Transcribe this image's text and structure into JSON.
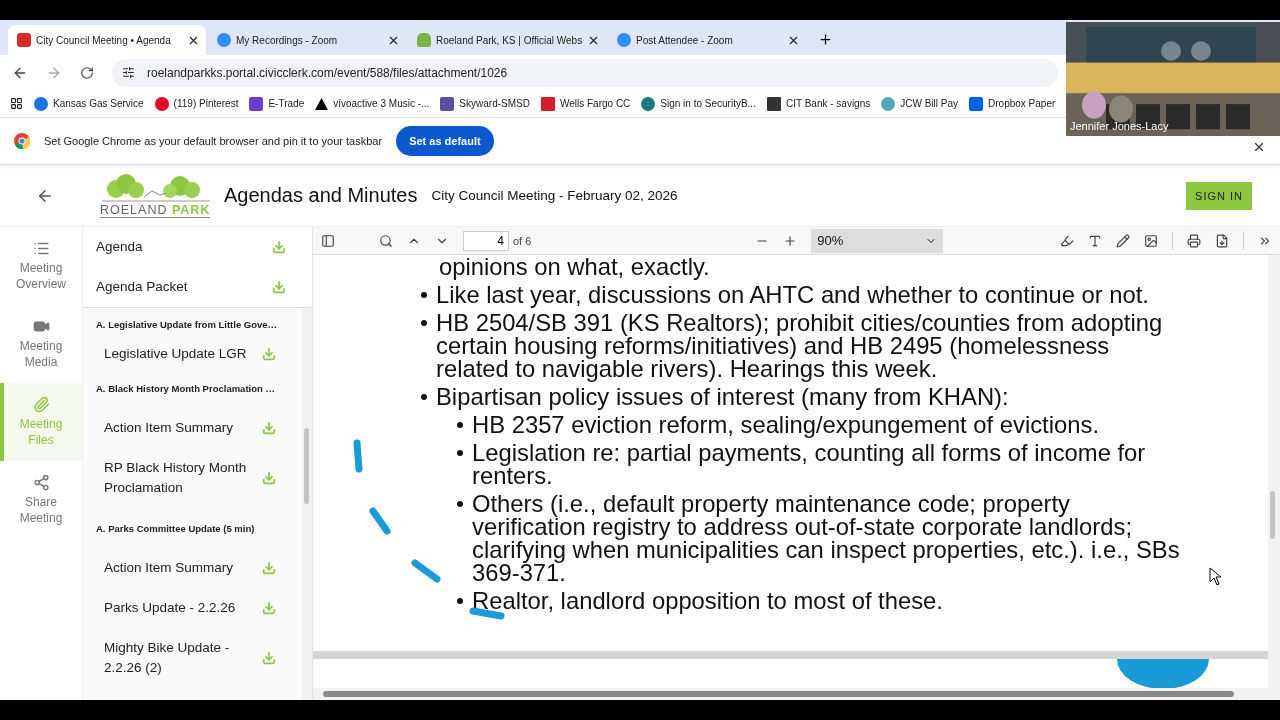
{
  "browser": {
    "tabs": [
      {
        "kind": "civic",
        "title": "City Council Meeting • Agenda",
        "selected": true
      },
      {
        "kind": "zoom",
        "title": "My Recordings - Zoom",
        "selected": false
      },
      {
        "kind": "site",
        "title": "Roeland Park, KS | Official Webs",
        "selected": false
      },
      {
        "kind": "zoom",
        "title": "Post Attendee - Zoom",
        "selected": false
      }
    ],
    "url": "roelandparkks.portal.civicclerk.com/event/588/files/attachment/1026",
    "bookmarks": [
      {
        "kind": "gas",
        "label": "Kansas Gas Service"
      },
      {
        "kind": "pinterest",
        "label": "(119) Pinterest"
      },
      {
        "kind": "etrade",
        "label": "E-Trade"
      },
      {
        "kind": "garmin",
        "label": "vívoactive 3 Music -..."
      },
      {
        "kind": "skyward",
        "label": "Skyward-SMSD"
      },
      {
        "kind": "wellsfargo",
        "label": "Wells Fargo CC"
      },
      {
        "kind": "security",
        "label": "Sign in to SecurityB..."
      },
      {
        "kind": "cit",
        "label": "CIT Bank - savigns"
      },
      {
        "kind": "jcw",
        "label": "JCW Bill Pay"
      },
      {
        "kind": "dropbox",
        "label": "Dropbox Paper"
      }
    ],
    "banner": {
      "message": "Set Google Chrome as your default browser and pin it to your taskbar",
      "button": "Set as default"
    }
  },
  "video": {
    "kind": "picture",
    "name": "Jennifer Jones-Lacy"
  },
  "header": {
    "logo": [
      "ROELAND",
      "PARK"
    ],
    "title": "Agendas and Minutes",
    "meeting": "City Council Meeting - February 02, 2026",
    "sign_in": "SIGN IN"
  },
  "nav": [
    {
      "kind": "list",
      "lines": [
        "Meeting",
        "Overview"
      ],
      "selected": false
    },
    {
      "kind": "video",
      "lines": [
        "Meeting",
        "Media"
      ],
      "selected": false
    },
    {
      "kind": "clip",
      "lines": [
        "Meeting",
        "Files"
      ],
      "selected": true
    },
    {
      "kind": "share",
      "lines": [
        "Share",
        "Meeting"
      ],
      "selected": false
    }
  ],
  "files": {
    "pinned": [
      {
        "label": "Agenda"
      },
      {
        "label": "Agenda Packet"
      }
    ],
    "sections": [
      {
        "title": "A. Legislative Update from Little Gove…",
        "files": [
          {
            "label": "Legislative Update LGR"
          }
        ]
      },
      {
        "title": "A. Black History Month Proclamation …",
        "files": [
          {
            "label": "Action Item Summary"
          },
          {
            "label": "RP Black History Month Proclamation"
          }
        ]
      },
      {
        "title": "A. Parks Committee Update (5 min)",
        "files": [
          {
            "label": "Action Item Summary"
          },
          {
            "label": "Parks Update - 2.2.26"
          },
          {
            "label": "Mighty Bike Update - 2.2.26 (2)"
          }
        ]
      }
    ]
  },
  "viewer": {
    "page": "4",
    "of": "of 6",
    "zoom": "90%",
    "lead": "opinions on what, exactly.",
    "bullets": [
      {
        "text": "Like last year, discussions on AHTC and whether to continue or not."
      },
      {
        "text": "HB 2504/SB 391 (KS Realtors); prohibit cities/counties from adopting certain housing reforms/initiatives) and HB 2495 (homelessness related to navigable rivers). Hearings this week."
      },
      {
        "text": "Bipartisan policy issues of interest (many from KHAN):",
        "children": [
          {
            "text": "HB 2357 eviction reform, sealing/expungement of evictions."
          },
          {
            "text": "Legislation re: partial payments, counting all forms of income for renters."
          },
          {
            "text": "Others (i.e., default property maintenance code; property verification registry to address out-of-state corporate landlords; clarifying when municipalities can inspect properties, etc.). i.e., SBs 369-371."
          },
          {
            "text": "Realtor, landlord opposition to most of these."
          }
        ]
      }
    ]
  }
}
